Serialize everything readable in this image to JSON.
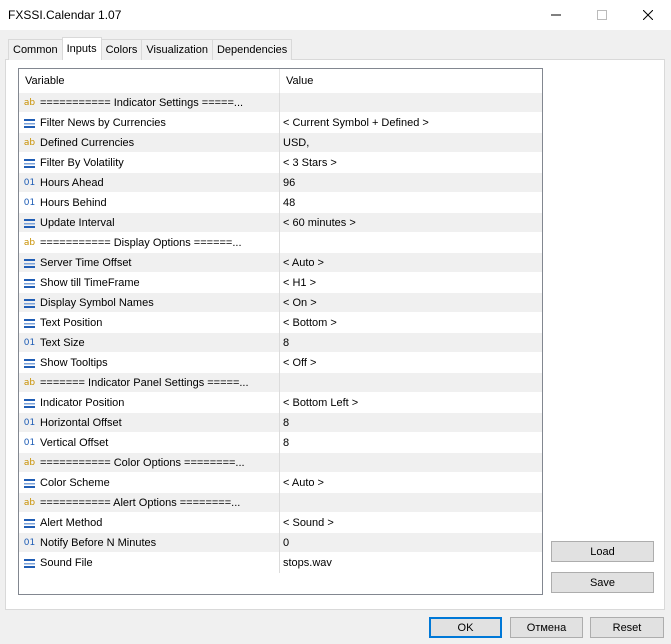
{
  "window": {
    "title": "FXSSI.Calendar 1.07"
  },
  "tabs": [
    {
      "label": "Common",
      "active": false
    },
    {
      "label": "Inputs",
      "active": true
    },
    {
      "label": "Colors",
      "active": false
    },
    {
      "label": "Visualization",
      "active": false
    },
    {
      "label": "Dependencies",
      "active": false
    }
  ],
  "grid": {
    "headers": {
      "variable": "Variable",
      "value": "Value"
    },
    "rows": [
      {
        "icon": "string-icon",
        "variable": "=========== Indicator Settings =====...",
        "value": ""
      },
      {
        "icon": "enum-icon",
        "variable": "Filter News by Currencies",
        "value": "< Current Symbol + Defined >"
      },
      {
        "icon": "string-icon",
        "variable": "Defined Currencies",
        "value": "USD,"
      },
      {
        "icon": "enum-icon",
        "variable": "Filter By Volatility",
        "value": "< 3 Stars >"
      },
      {
        "icon": "integer-icon",
        "variable": "Hours Ahead",
        "value": "96"
      },
      {
        "icon": "integer-icon",
        "variable": "Hours Behind",
        "value": "48"
      },
      {
        "icon": "enum-icon",
        "variable": "Update Interval",
        "value": "< 60 minutes >"
      },
      {
        "icon": "string-icon",
        "variable": "=========== Display Options ======...",
        "value": ""
      },
      {
        "icon": "enum-icon",
        "variable": "Server Time Offset",
        "value": "< Auto >"
      },
      {
        "icon": "enum-icon",
        "variable": "Show till TimeFrame",
        "value": "< H1 >"
      },
      {
        "icon": "enum-icon",
        "variable": "Display Symbol Names",
        "value": "< On >"
      },
      {
        "icon": "enum-icon",
        "variable": "Text Position",
        "value": "< Bottom >"
      },
      {
        "icon": "integer-icon",
        "variable": "Text Size",
        "value": "8"
      },
      {
        "icon": "enum-icon",
        "variable": "Show Tooltips",
        "value": "< Off >"
      },
      {
        "icon": "string-icon",
        "variable": "======= Indicator Panel Settings =====...",
        "value": ""
      },
      {
        "icon": "enum-icon",
        "variable": "Indicator Position",
        "value": "< Bottom Left >"
      },
      {
        "icon": "integer-icon",
        "variable": "Horizontal Offset",
        "value": "8"
      },
      {
        "icon": "integer-icon",
        "variable": "Vertical Offset",
        "value": "8"
      },
      {
        "icon": "string-icon",
        "variable": "=========== Color Options ========...",
        "value": ""
      },
      {
        "icon": "enum-icon",
        "variable": "Color Scheme",
        "value": "< Auto >"
      },
      {
        "icon": "string-icon",
        "variable": "=========== Alert Options ========...",
        "value": ""
      },
      {
        "icon": "enum-icon",
        "variable": "Alert Method",
        "value": "< Sound >"
      },
      {
        "icon": "integer-icon",
        "variable": "Notify Before N Minutes",
        "value": "0"
      },
      {
        "icon": "enum-icon",
        "variable": "Sound File",
        "value": "stops.wav"
      }
    ]
  },
  "icon_glyphs": {
    "string": "ab",
    "integer": "01"
  },
  "buttons": {
    "load": "Load",
    "save": "Save",
    "ok": "OK",
    "cancel": "Отмена",
    "reset": "Reset"
  },
  "colors": {
    "string_icon": "#c89000",
    "integer_icon": "#1f5db5",
    "enum_icon": "#1f5db5",
    "ok_border": "#0078d7"
  }
}
